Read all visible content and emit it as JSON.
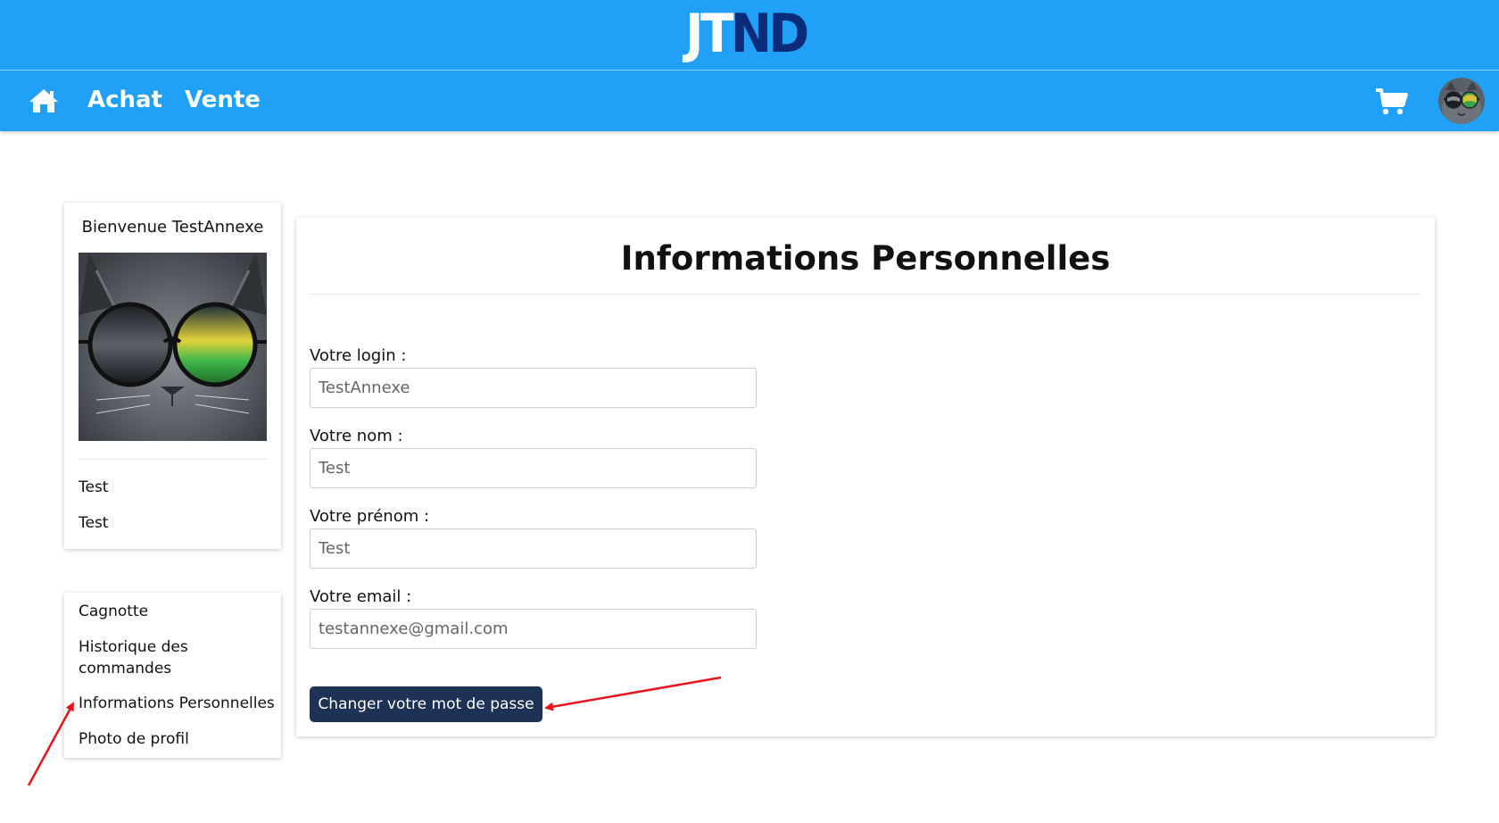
{
  "header": {
    "logo": {
      "part1": "JT",
      "part2": "ND",
      "color_part1": "#ffffff",
      "color_part2": "#0a2a7a"
    },
    "background": "#20a0f7"
  },
  "nav": {
    "home_icon": "home-icon",
    "links": [
      "Achat",
      "Vente"
    ],
    "cart_icon": "shopping-cart-icon",
    "avatar_icon": "cat-sunglasses-avatar"
  },
  "sidebar": {
    "welcome": "Bienvenue TestAnnexe",
    "profile_image": "cat-with-round-sunglasses",
    "name_lines": [
      "Test",
      "Test"
    ],
    "menu": [
      "Cagnotte",
      "Historique des commandes",
      "Informations Personnelles",
      "Photo de profil"
    ]
  },
  "main": {
    "title": "Informations Personnelles",
    "fields": [
      {
        "label": "Votre login :",
        "value": "TestAnnexe"
      },
      {
        "label": "Votre nom :",
        "value": "Test"
      },
      {
        "label": "Votre prénom :",
        "value": "Test"
      },
      {
        "label": "Votre email :",
        "value": "testannexe@gmail.com"
      }
    ],
    "button_label": "Changer votre mot de passe",
    "button_color": "#1e3256"
  },
  "annotations": {
    "arrow_color": "#e8141c",
    "arrows": [
      "arrow-to-menu-informations",
      "arrow-to-change-password"
    ]
  }
}
